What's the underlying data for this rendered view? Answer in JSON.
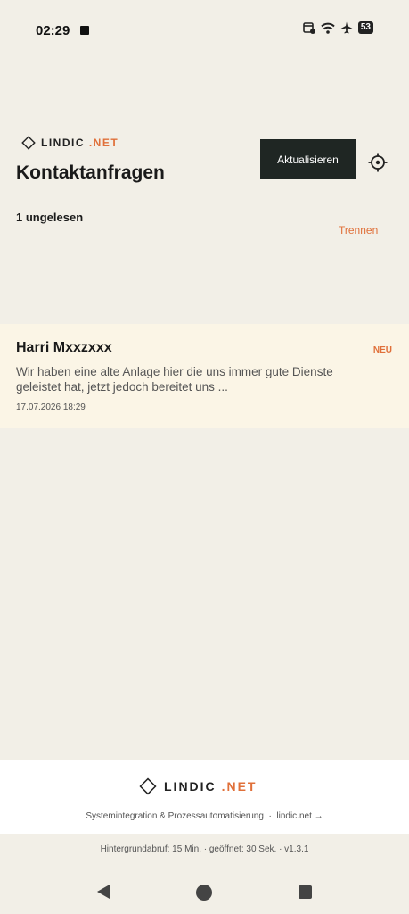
{
  "status_bar": {
    "time": "02:29",
    "icons": [
      "notification-square-icon",
      "calendar-alarm-icon",
      "wifi-icon",
      "airplane-icon",
      "battery-icon"
    ],
    "battery": "53"
  },
  "header": {
    "brand_main": "LINDIC",
    "brand_accent": ".NET",
    "title": "Kontaktanfragen",
    "refresh_label": "Aktualisieren",
    "unread_label": "1 ungelesen",
    "disconnect_label": "Trennen"
  },
  "messages": [
    {
      "name": "Harri Mxxzxxx",
      "badge": "NEU",
      "preview": "Wir haben eine alte Anlage hier die uns immer gute Dienste geleistet hat, jetzt jedoch bereitet uns ...",
      "date": "17.07.2026 18:29"
    }
  ],
  "footer": {
    "brand_main": "LINDIC",
    "brand_accent": ".NET",
    "tagline": "Systemintegration & Prozessautomatisierung",
    "separator": "·",
    "link": "lindic.net →",
    "meta": "Hintergrundabruf: 15 Min. · geöffnet: 30 Sek. · v1.3.1"
  },
  "colors": {
    "background": "#f2efe7",
    "accent": "#e0703a",
    "button_dark": "#1f2623",
    "card_highlight": "#fbf5e6"
  }
}
